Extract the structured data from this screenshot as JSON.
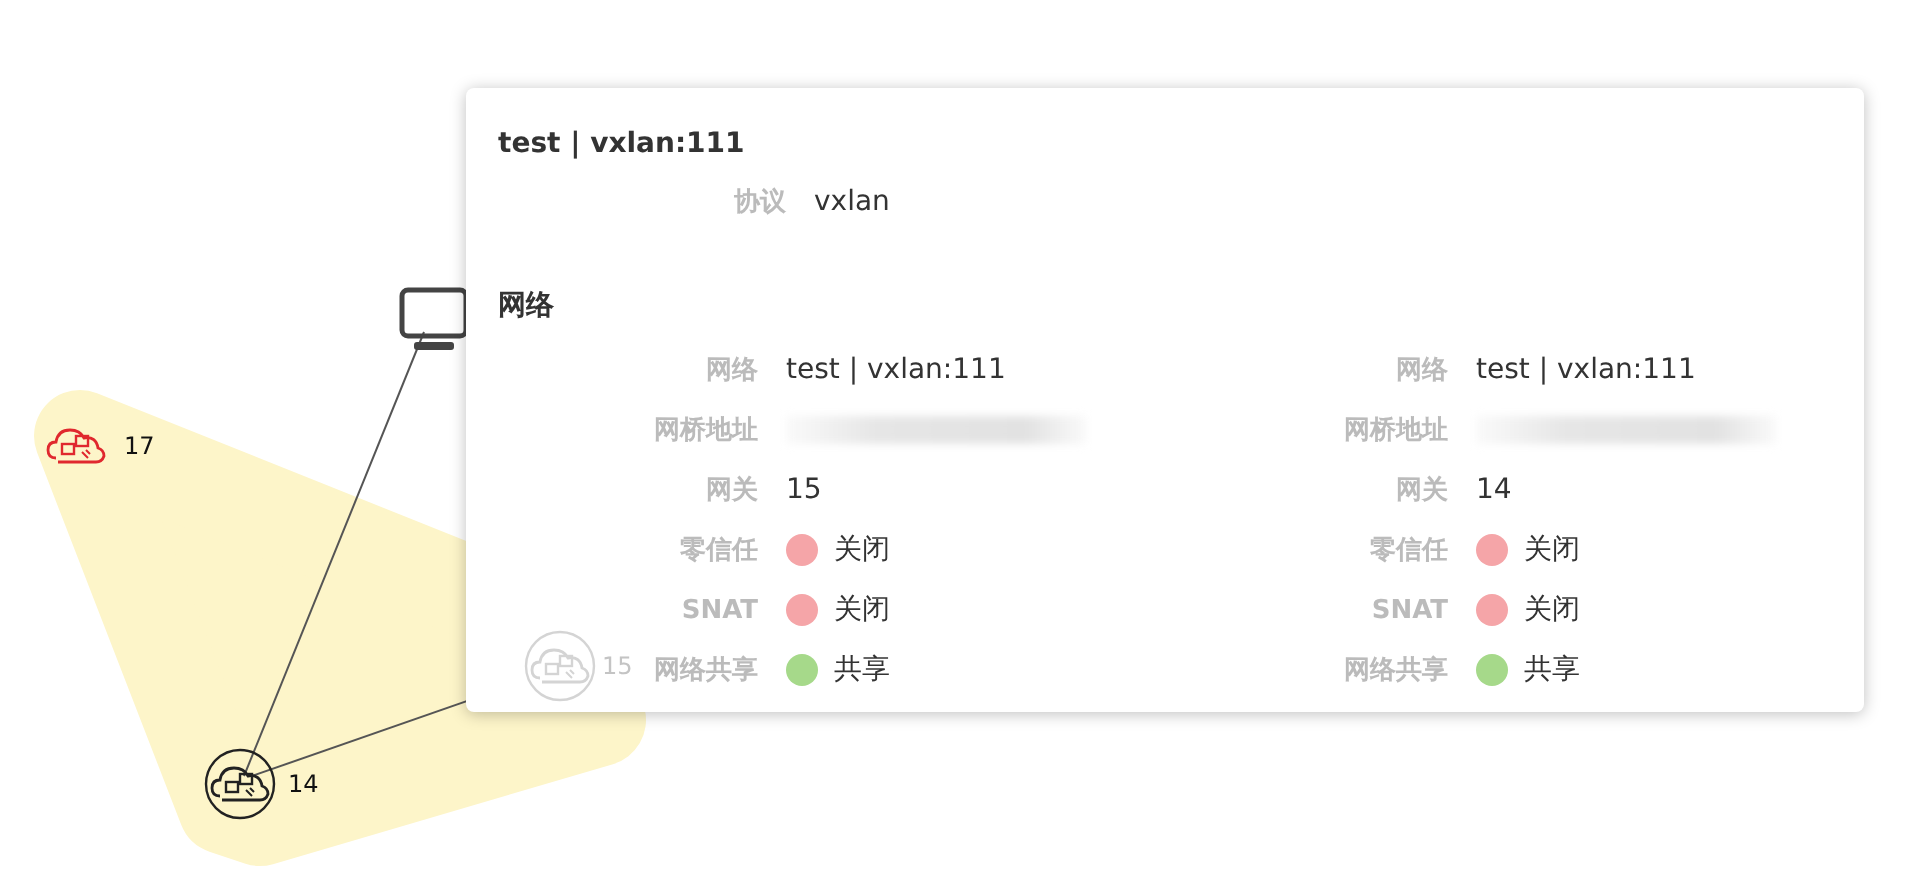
{
  "graph": {
    "nodes": [
      {
        "kind": "cloud",
        "label": "17",
        "color": "#e0282e",
        "ringed": false,
        "faded": false
      },
      {
        "kind": "cloud",
        "label": "14",
        "color": "#222222",
        "ringed": true,
        "faded": false
      },
      {
        "kind": "cloud",
        "label": "15",
        "color": "#d4d4d4",
        "ringed": true,
        "faded": true
      },
      {
        "kind": "monitor",
        "color": "#444444"
      }
    ]
  },
  "tooltip": {
    "title": "test | vxlan:111",
    "fields": [
      {
        "label": "协议",
        "value": "vxlan"
      }
    ],
    "section": "网络",
    "columns": [
      [
        {
          "kind": "text",
          "label": "网络",
          "value": "test | vxlan:111"
        },
        {
          "kind": "redacted",
          "label": "网桥地址"
        },
        {
          "kind": "text",
          "label": "网关",
          "value": "15"
        },
        {
          "kind": "status",
          "label": "零信任",
          "value": "关闭",
          "color": "#f5a5a8"
        },
        {
          "kind": "status",
          "label": "SNAT",
          "value": "关闭",
          "color": "#f5a5a8"
        },
        {
          "kind": "status",
          "label": "网络共享",
          "value": "共享",
          "color": "#a6d98a"
        }
      ],
      [
        {
          "kind": "text",
          "label": "网络",
          "value": "test | vxlan:111"
        },
        {
          "kind": "redacted",
          "label": "网桥地址"
        },
        {
          "kind": "text",
          "label": "网关",
          "value": "14"
        },
        {
          "kind": "status",
          "label": "零信任",
          "value": "关闭",
          "color": "#f5a5a8"
        },
        {
          "kind": "status",
          "label": "SNAT",
          "value": "关闭",
          "color": "#f5a5a8"
        },
        {
          "kind": "status",
          "label": "网络共享",
          "value": "共享",
          "color": "#a6d98a"
        }
      ]
    ]
  }
}
